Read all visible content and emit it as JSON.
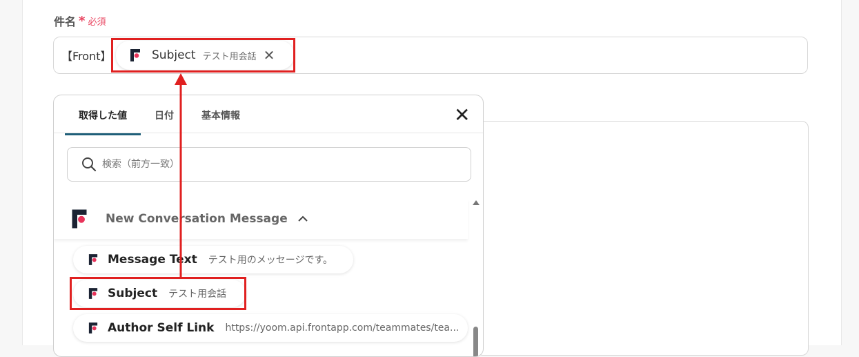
{
  "field": {
    "label": "件名",
    "required_mark": "*",
    "required_text": "必須",
    "prefix": "【Front】",
    "chip": {
      "name": "Subject",
      "sub": "テスト用会話",
      "remove": "✕"
    }
  },
  "popup": {
    "tabs": [
      "取得した値",
      "日付",
      "基本情報"
    ],
    "active_tab": "取得した値",
    "close": "✕",
    "search_placeholder": "検索（前方一致）",
    "group": {
      "title": "New Conversation Message",
      "expanded": true
    },
    "items": [
      {
        "name": "Message Text",
        "value": "テスト用のメッセージです。"
      },
      {
        "name": "Subject",
        "value": "テスト用会話"
      },
      {
        "name": "Author Self Link",
        "value": "https://yoom.api.frontapp.com/teammates/tea..."
      }
    ]
  },
  "colors": {
    "accent": "#1f5f79",
    "required": "#e94560",
    "highlight": "#e02020",
    "logo": "#1b2333",
    "logo_dot": "#e8335a"
  }
}
